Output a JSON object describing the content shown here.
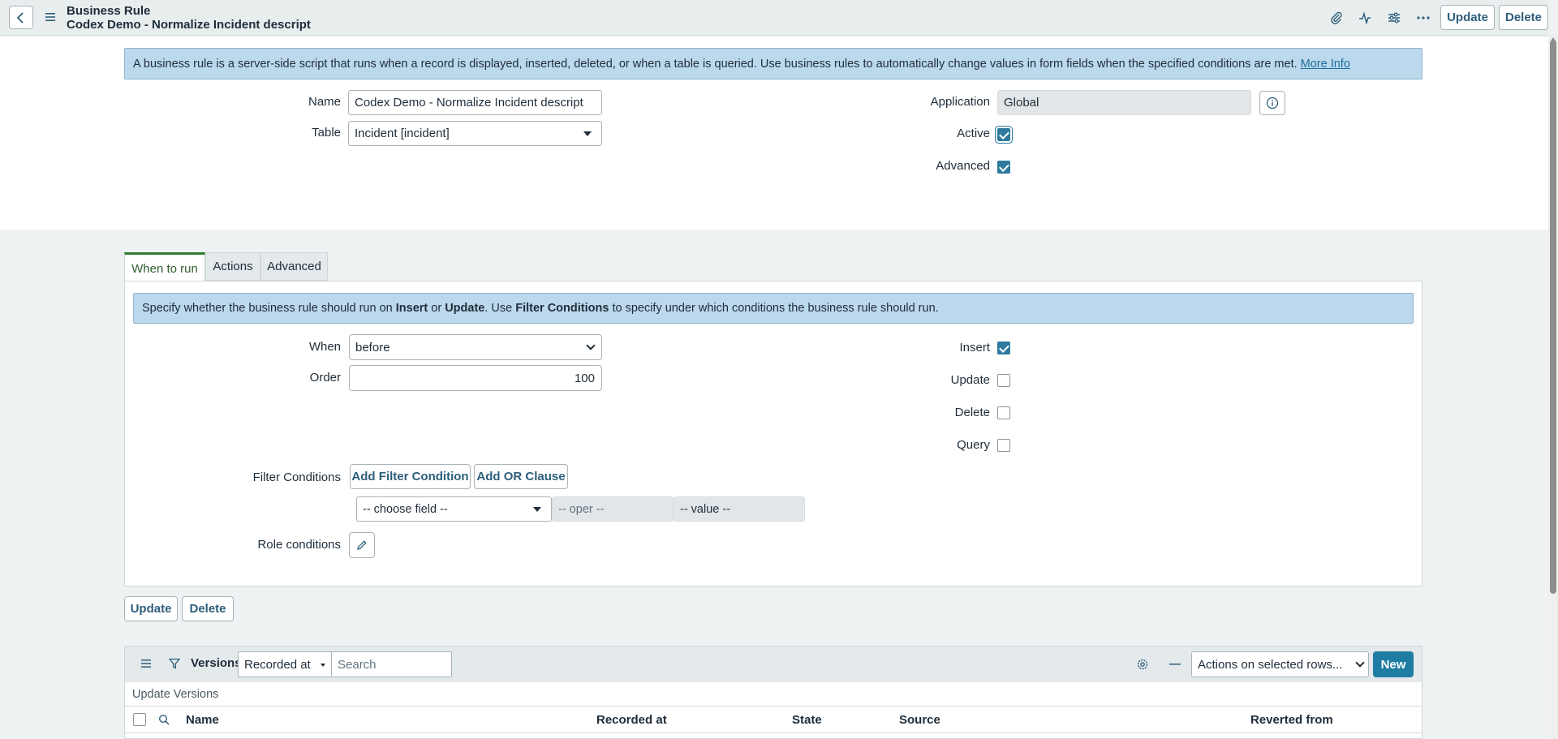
{
  "header": {
    "record_type": "Business Rule",
    "record_name": "Codex Demo - Normalize Incident descript",
    "update_label": "Update",
    "delete_label": "Delete"
  },
  "info": {
    "text": "A business rule is a server-side script that runs when a record is displayed, inserted, deleted, or when a table is queried. Use business rules to automatically change values in form fields when the specified conditions are met.",
    "link": "More Info"
  },
  "form": {
    "name_label": "Name",
    "name_value": "Codex Demo - Normalize Incident descript",
    "table_label": "Table",
    "table_value": "Incident [incident]",
    "application_label": "Application",
    "application_value": "Global",
    "active_label": "Active",
    "active": true,
    "advanced_label": "Advanced",
    "advanced": true
  },
  "tabs": [
    {
      "label": "When to run",
      "active": true
    },
    {
      "label": "Actions",
      "active": false
    },
    {
      "label": "Advanced",
      "active": false
    }
  ],
  "when_to_run": {
    "info_parts": [
      "Specify whether the business rule should run on ",
      "Insert",
      " or ",
      "Update",
      ". Use ",
      "Filter Conditions",
      " to specify under which conditions the business rule should run."
    ],
    "when_label": "When",
    "when_value": "before",
    "order_label": "Order",
    "order_value": "100",
    "insert_label": "Insert",
    "insert": true,
    "update_label": "Update",
    "update": false,
    "delete_label": "Delete",
    "delete": false,
    "query_label": "Query",
    "query": false,
    "filter_label": "Filter Conditions",
    "add_filter_label": "Add Filter Condition",
    "add_or_label": "Add OR Clause",
    "choose_field": "-- choose field --",
    "oper": "-- oper --",
    "value": "-- value --",
    "role_label": "Role conditions"
  },
  "bottom_buttons": {
    "update_label": "Update",
    "delete_label": "Delete"
  },
  "versions": {
    "title": "Versions",
    "sort_field": "Recorded at",
    "search_placeholder": "Search",
    "actions_label": "Actions on selected rows...",
    "new_label": "New",
    "subtitle": "Update Versions",
    "columns": [
      "Name",
      "Recorded at",
      "State",
      "Source",
      "Reverted from"
    ]
  },
  "colors": {
    "accent": "#2e7a9c",
    "info_bg": "#bbd8ec",
    "tab_active": "#2e7d32",
    "new_button": "#1f7ca3"
  }
}
